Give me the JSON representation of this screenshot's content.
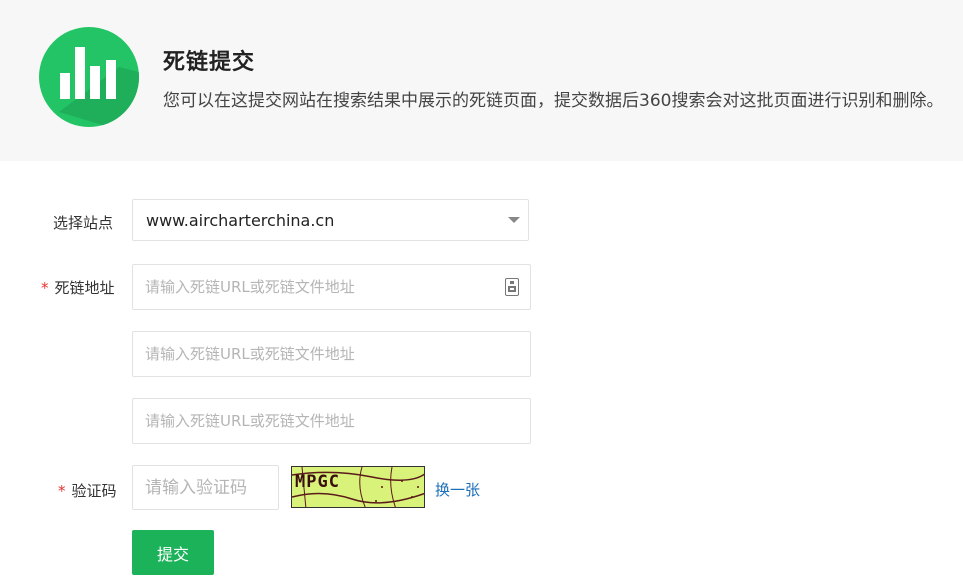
{
  "header": {
    "title": "死链提交",
    "description": "您可以在这提交网站在搜索结果中展示的死链页面，提交数据后360搜索会对这批页面进行识别和删除。",
    "logo_icon": "bar-chart-icon",
    "accent_color": "#23c465"
  },
  "form": {
    "site_label": "选择站点",
    "site_value": "www.aircharterchina.cn",
    "required_mark": "*",
    "deadlink_label": "死链地址",
    "url_placeholder": "请输入死链URL或死链文件地址",
    "captcha_label": "验证码",
    "captcha_placeholder": "请输入验证码",
    "captcha_text": "MPGC",
    "refresh_label": "换一张",
    "submit_label": "提交",
    "submit_color": "#1cb25a"
  }
}
